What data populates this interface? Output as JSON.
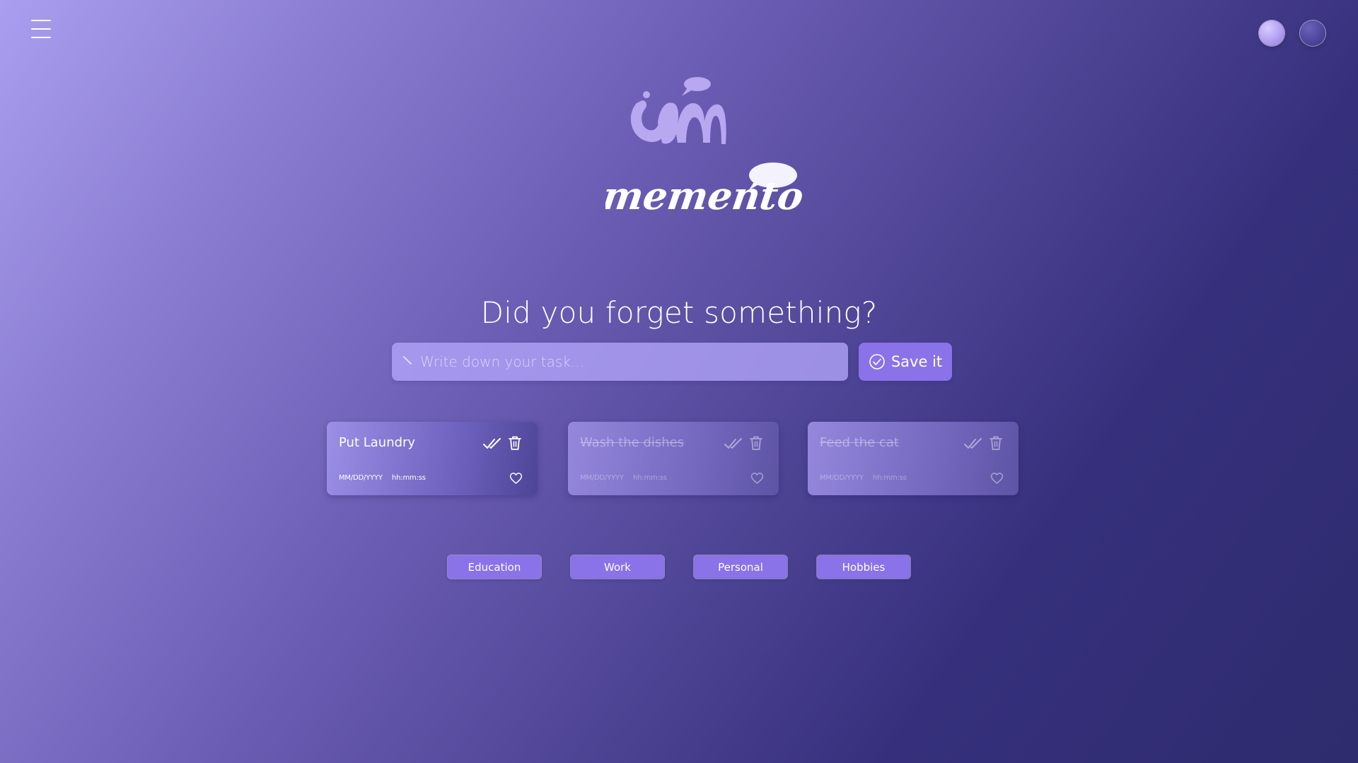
{
  "header": {
    "menu_icon": "hamburger-menu-icon",
    "theme_options": [
      {
        "name": "light-theme",
        "color": "#a793ee"
      },
      {
        "name": "dark-theme",
        "color": "#4a4296"
      }
    ]
  },
  "brand": {
    "name": "memento",
    "logo_icon": "memento-logo-mark"
  },
  "main": {
    "headline": "Did you forget something?",
    "task_input": {
      "placeholder": "Write down your task...",
      "value": "",
      "icon": "pencil-icon"
    },
    "save_button": {
      "label": "Save it",
      "icon": "check-circle-icon"
    }
  },
  "tasks": [
    {
      "title": "Put Laundry",
      "date": "MM/DD/YYYY",
      "time": "hh:mm:ss",
      "completed": false
    },
    {
      "title": "Wash the dishes",
      "date": "MM/DD/YYYY",
      "time": "hh:mm:ss",
      "completed": true
    },
    {
      "title": "Feed the cat",
      "date": "MM/DD/YYYY",
      "time": "hh:mm:ss",
      "completed": true
    }
  ],
  "categories": [
    {
      "label": "Education"
    },
    {
      "label": "Work"
    },
    {
      "label": "Personal"
    },
    {
      "label": "Hobbies"
    }
  ],
  "colors": {
    "accent": "#8a72e8",
    "background_start": "#aa9ef0",
    "background_end": "#2e2b6e",
    "input_background": "#b2a5fa"
  }
}
